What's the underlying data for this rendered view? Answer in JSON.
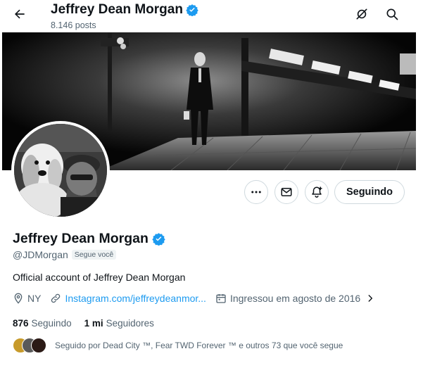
{
  "header": {
    "name": "Jeffrey Dean Morgan",
    "posts": "8.146 posts"
  },
  "profile": {
    "name": "Jeffrey Dean Morgan",
    "handle": "@JDMorgan",
    "follows_you": "Segue você",
    "bio": "Official account of Jeffrey Dean Morgan",
    "location": "NY",
    "link": "Instagram.com/jeffreydeanmor...",
    "joined": "Ingressou em agosto de 2016",
    "following_count": "876",
    "following_label": "Seguindo",
    "followers_count": "1 mi",
    "followers_label": "Seguidores",
    "followed_by": "Seguido por Dead City ™, Fear TWD Forever ™ e outros 73 que você segue"
  },
  "actions": {
    "follow_label": "Seguindo"
  },
  "icons": {
    "back": "arrow-left-icon",
    "grok": "grok-icon",
    "search": "search-icon",
    "more": "more-icon",
    "message": "envelope-icon",
    "notify": "bell-plus-icon",
    "verified": "verified-badge-icon",
    "location": "location-pin-icon",
    "link": "link-icon",
    "calendar": "calendar-icon",
    "chevron": "chevron-right-icon"
  },
  "colors": {
    "accent": "#1d9bf0",
    "text": "#0f1419",
    "muted": "#536471",
    "border": "#cfd9de"
  }
}
